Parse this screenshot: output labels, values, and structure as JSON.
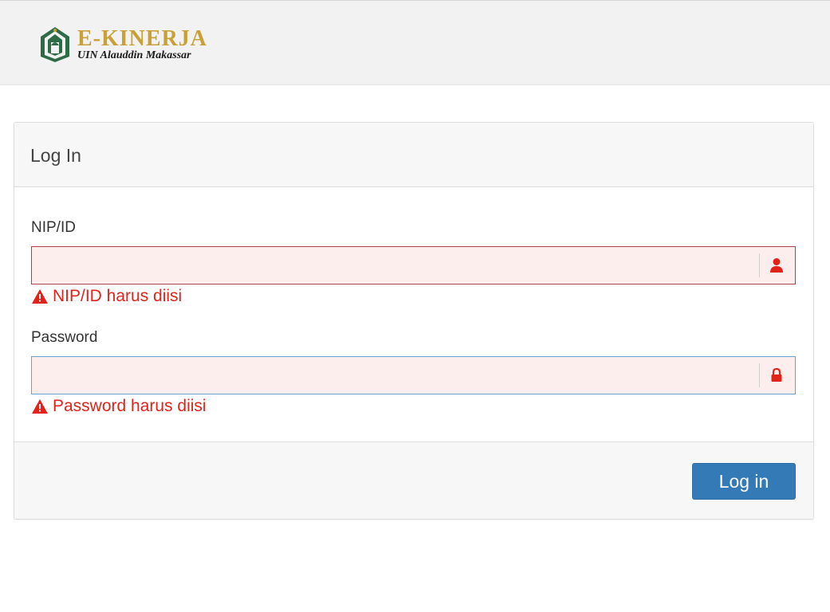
{
  "header": {
    "brand_title": "E-KINERJA",
    "brand_subtitle": "UIN Alauddin Makassar",
    "logo_icon": "mosque-emblem-icon"
  },
  "login": {
    "title": "Log In",
    "nip_label": "NIP/ID",
    "nip_value": "",
    "nip_icon": "user-icon",
    "nip_error": "NIP/ID harus diisi",
    "password_label": "Password",
    "password_value": "",
    "password_icon": "lock-icon",
    "password_error": "Password harus diisi",
    "error_icon": "warning-icon",
    "submit_label": "Log in"
  },
  "colors": {
    "brand_gold": "#c9a035",
    "brand_green": "#2e6b46",
    "error_red": "#e2231a",
    "error_border": "#a94442",
    "input_bg": "#fdeeee",
    "primary_button": "#337ab7"
  }
}
